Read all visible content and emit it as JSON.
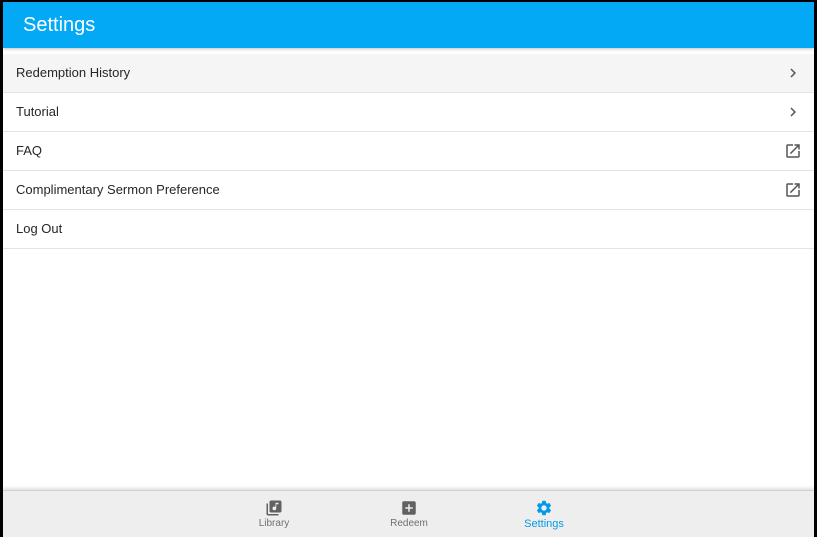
{
  "appbar": {
    "title": "Settings"
  },
  "list": {
    "items": [
      {
        "label": "Redemption History",
        "icon": "chevron-right-icon"
      },
      {
        "label": "Tutorial",
        "icon": "chevron-right-icon"
      },
      {
        "label": "FAQ",
        "icon": "open-in-new-icon"
      },
      {
        "label": "Complimentary Sermon Preference",
        "icon": "open-in-new-icon"
      },
      {
        "label": "Log Out",
        "icon": ""
      }
    ]
  },
  "bottom_nav": {
    "items": [
      {
        "label": "Library",
        "icon": "library-music-icon",
        "active": false
      },
      {
        "label": "Redeem",
        "icon": "add-box-icon",
        "active": false
      },
      {
        "label": "Settings",
        "icon": "gear-icon",
        "active": true
      }
    ]
  },
  "colors": {
    "primary": "#03a9f4",
    "active_tab": "#039be5",
    "inactive_tab": "#6f6f6f",
    "bottom_nav_bg": "#eeeeee"
  }
}
